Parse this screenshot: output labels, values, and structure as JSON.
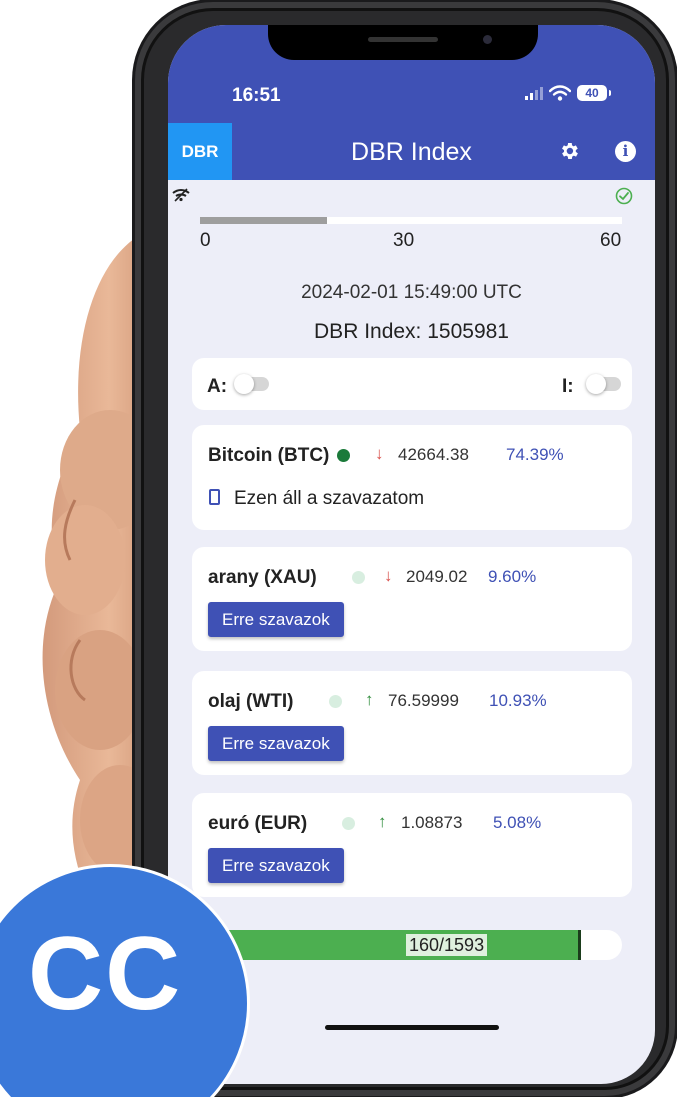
{
  "status_bar": {
    "time": "16:51",
    "battery": "40"
  },
  "header": {
    "logo": "DBR",
    "title": "DBR Index",
    "settings_icon": "gear-icon",
    "info_icon": "info-icon"
  },
  "timer": {
    "connection_icon": "wifi-icon",
    "status_icon": "check-circle-icon",
    "progress": 0.3,
    "labels": [
      "0",
      "30",
      "60"
    ]
  },
  "index": {
    "timestamp": "2024-02-01 15:49:00 UTC",
    "value_text": "DBR Index: 1505981"
  },
  "toggles": {
    "a_label": "A:",
    "i_label": "I:",
    "a_on": false,
    "i_on": false
  },
  "assets": [
    {
      "name": "Bitcoin (BTC)",
      "status": "active",
      "trend": "down",
      "arrow": "↓",
      "price": "42664.38",
      "share": "74.39%",
      "my_vote_text": "Ezen áll a szavazatom"
    },
    {
      "name": "arany (XAU)",
      "status": "inactive",
      "trend": "down",
      "arrow": "↓",
      "price": "2049.02",
      "share": "9.60%",
      "button_label": "Erre szavazok"
    },
    {
      "name": "olaj (WTI)",
      "status": "inactive",
      "trend": "up",
      "arrow": "↑",
      "price": "76.59999",
      "share": "10.93%",
      "button_label": "Erre szavazok"
    },
    {
      "name": "euró (EUR)",
      "status": "inactive",
      "trend": "up",
      "arrow": "↑",
      "price": "1.08873",
      "share": "5.08%",
      "button_label": "Erre szavazok"
    }
  ],
  "vote_progress": {
    "label": "160/1593",
    "fraction": 0.9
  },
  "badge": {
    "text": "CC"
  },
  "colors": {
    "primary": "#3f51b5",
    "logo_bg": "#2196f3",
    "active_dot": "#1b7a3a",
    "inactive_dot": "#d8eee0",
    "down_arrow": "#d9534f",
    "up_arrow": "#2e8b3a",
    "progress_green": "#4caf50",
    "badge_blue": "#3a78d9"
  }
}
